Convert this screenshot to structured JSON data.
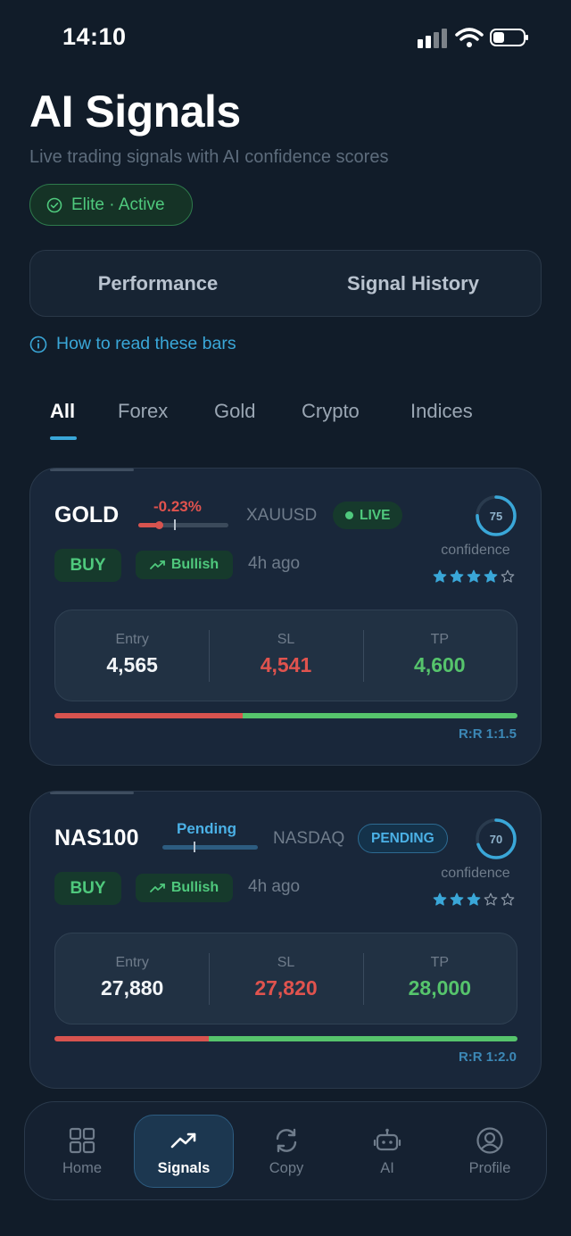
{
  "status_bar": {
    "time": "14:10"
  },
  "header": {
    "title": "AI Signals",
    "subtitle": "Live trading signals with AI confidence scores",
    "tier_badge": "Elite · Active"
  },
  "segments": [
    "Performance",
    "Signal History"
  ],
  "help_link": "How to read these bars",
  "filters": [
    "All",
    "Forex",
    "Gold",
    "Crypto",
    "Indices"
  ],
  "active_filter": "All",
  "signals": [
    {
      "symbol": "GOLD",
      "change": "-0.23%",
      "exchange": "XAUUSD",
      "status": "LIVE",
      "confidence": "75",
      "confidence_fraction": 0.75,
      "confidence_label": "confidence",
      "stars": 4,
      "side": "BUY",
      "trend": "Bullish",
      "age": "4h ago",
      "levels": {
        "entry_label": "Entry",
        "entry": "4,565",
        "sl_label": "SL",
        "sl": "4,541",
        "tp_label": "TP",
        "tp": "4,600"
      },
      "risk_fraction": 0.407,
      "rr": "R:R 1:1.5"
    },
    {
      "symbol": "NAS100",
      "change": "Pending",
      "exchange": "NASDAQ",
      "status": "PENDING",
      "confidence": "70",
      "confidence_fraction": 0.7,
      "confidence_label": "confidence",
      "stars": 3,
      "side": "BUY",
      "trend": "Bullish",
      "age": "4h ago",
      "levels": {
        "entry_label": "Entry",
        "entry": "27,880",
        "sl_label": "SL",
        "sl": "27,820",
        "tp_label": "TP",
        "tp": "28,000"
      },
      "risk_fraction": 0.333,
      "rr": "R:R 1:2.0"
    }
  ],
  "bottom_nav": [
    {
      "label": "Home",
      "icon": "grid-icon"
    },
    {
      "label": "Signals",
      "icon": "trending-up-icon"
    },
    {
      "label": "Copy",
      "icon": "refresh-icon"
    },
    {
      "label": "AI",
      "icon": "robot-icon"
    },
    {
      "label": "Profile",
      "icon": "user-circle-icon"
    }
  ],
  "active_nav": "Signals",
  "colors": {
    "background": "#111c29",
    "accent": "#3aa7d8",
    "buy_green": "#56c46c",
    "sell_red": "#d7534f"
  }
}
